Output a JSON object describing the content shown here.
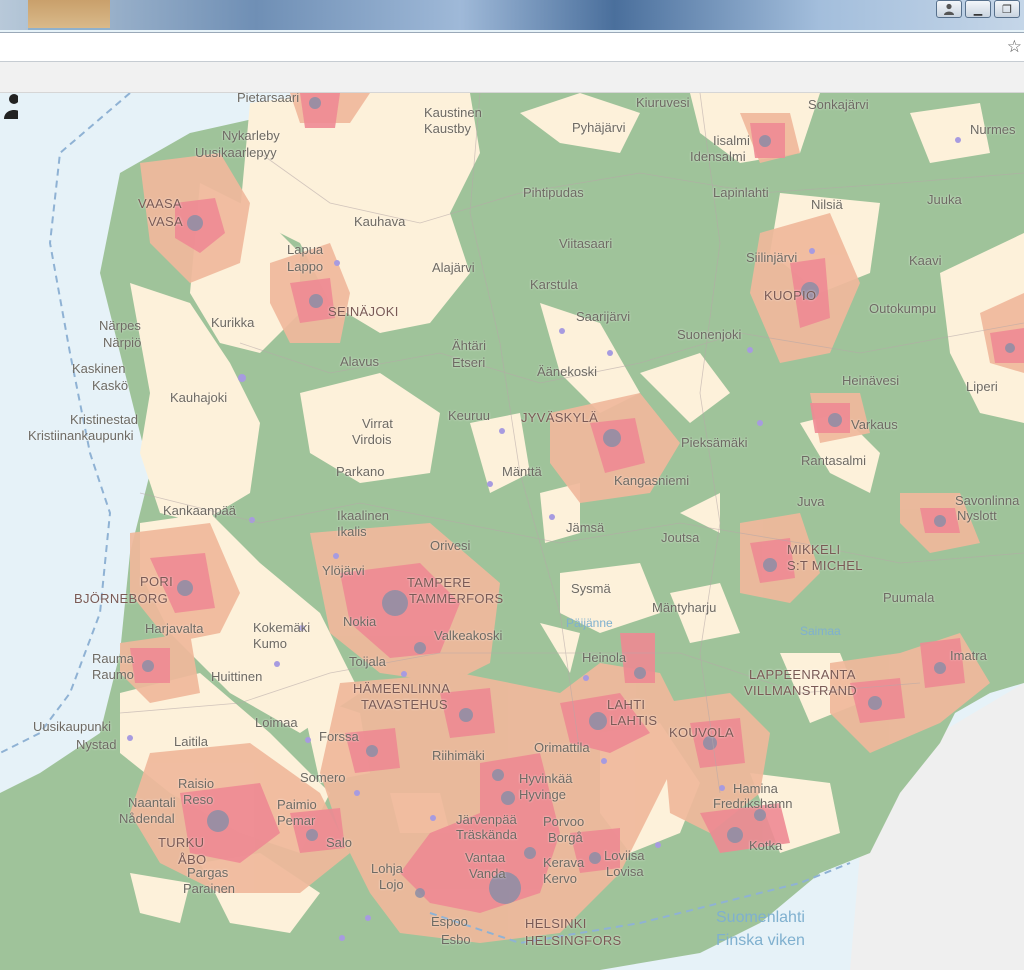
{
  "window": {
    "minimize_label": "▁",
    "restore_label": "❐",
    "account_icon": "user-account-icon"
  },
  "colors": {
    "sea": "#e6f2f8",
    "forest": "#9fc39a",
    "open": "#fdf1da",
    "zone_low": "#f0b99c",
    "zone_high": "#ee8a93",
    "urban": "#8c8ea6"
  },
  "map": {
    "places": [
      {
        "id": "pietarsaari",
        "text": "Pietarsaari"
      },
      {
        "id": "kaustinen",
        "text": "Kaustinen"
      },
      {
        "id": "kaustby",
        "text": "Kaustby"
      },
      {
        "id": "kiuruvesi",
        "text": "Kiuruvesi"
      },
      {
        "id": "sonkajarvi",
        "text": "Sonkajärvi"
      },
      {
        "id": "nurmes",
        "text": "Nurmes"
      },
      {
        "id": "nykarleby",
        "text": "Nykarleby"
      },
      {
        "id": "uusikaarlepyy",
        "text": "Uusikaarlepyy"
      },
      {
        "id": "pyhajarvi",
        "text": "Pyhäjärvi"
      },
      {
        "id": "iisalmi",
        "text": "Iisalmi"
      },
      {
        "id": "idensalmi",
        "text": "Idensalmi"
      },
      {
        "id": "pihtipudas",
        "text": "Pihtipudas"
      },
      {
        "id": "lapinlahti",
        "text": "Lapinlahti"
      },
      {
        "id": "nilsia",
        "text": "Nilsiä"
      },
      {
        "id": "juuka",
        "text": "Juuka"
      },
      {
        "id": "vaasa",
        "text": "VAASA"
      },
      {
        "id": "vasa",
        "text": "VASA"
      },
      {
        "id": "kauhava",
        "text": "Kauhava"
      },
      {
        "id": "lapua",
        "text": "Lapua"
      },
      {
        "id": "lappo",
        "text": "Lappo"
      },
      {
        "id": "viitasaari",
        "text": "Viitasaari"
      },
      {
        "id": "siilinjarvi",
        "text": "Siilinjärvi"
      },
      {
        "id": "kaavi",
        "text": "Kaavi"
      },
      {
        "id": "alajarvi",
        "text": "Alajärvi"
      },
      {
        "id": "karstula",
        "text": "Karstula"
      },
      {
        "id": "kuopio",
        "text": "KUOPIO"
      },
      {
        "id": "seinajoki",
        "text": "SEINÄJOKI"
      },
      {
        "id": "saarijarvi",
        "text": "Saarijärvi"
      },
      {
        "id": "outokumpu",
        "text": "Outokumpu"
      },
      {
        "id": "narpes",
        "text": "Närpes"
      },
      {
        "id": "narpio",
        "text": "Närpiö"
      },
      {
        "id": "kurikka",
        "text": "Kurikka"
      },
      {
        "id": "suonenjoki",
        "text": "Suonenjoki"
      },
      {
        "id": "ahtari",
        "text": "Ähtäri"
      },
      {
        "id": "etseri",
        "text": "Etseri"
      },
      {
        "id": "alavus",
        "text": "Alavus"
      },
      {
        "id": "kaskinen",
        "text": "Kaskinen"
      },
      {
        "id": "kasko",
        "text": "Kaskö"
      },
      {
        "id": "aanekoski",
        "text": "Äänekoski"
      },
      {
        "id": "heinavesi",
        "text": "Heinävesi"
      },
      {
        "id": "liperi",
        "text": "Liperi"
      },
      {
        "id": "kauhajoki",
        "text": "Kauhajoki"
      },
      {
        "id": "kristinestad",
        "text": "Kristinestad"
      },
      {
        "id": "kristiinankaupunki",
        "text": "Kristiinankaupunki"
      },
      {
        "id": "keuruu",
        "text": "Keuruu"
      },
      {
        "id": "jyvaskyla",
        "text": "JYVÄSKYLÄ"
      },
      {
        "id": "virrat",
        "text": "Virrat"
      },
      {
        "id": "virdois",
        "text": "Virdois"
      },
      {
        "id": "varkaus",
        "text": "Varkaus"
      },
      {
        "id": "pieksamaki",
        "text": "Pieksämäki"
      },
      {
        "id": "rantasalmi",
        "text": "Rantasalmi"
      },
      {
        "id": "parkano",
        "text": "Parkano"
      },
      {
        "id": "mantta",
        "text": "Mänttä"
      },
      {
        "id": "kangasniemi",
        "text": "Kangasniemi"
      },
      {
        "id": "juva",
        "text": "Juva"
      },
      {
        "id": "savonlinna",
        "text": "Savonlinna"
      },
      {
        "id": "nyslott",
        "text": "Nyslott"
      },
      {
        "id": "kankaanpaa",
        "text": "Kankaanpää"
      },
      {
        "id": "ikaalinen",
        "text": "Ikaalinen"
      },
      {
        "id": "ikalis",
        "text": "Ikalis"
      },
      {
        "id": "jamsa",
        "text": "Jämsä"
      },
      {
        "id": "joutsa",
        "text": "Joutsa"
      },
      {
        "id": "orivesi",
        "text": "Orivesi"
      },
      {
        "id": "mikkeli",
        "text": "MIKKELI"
      },
      {
        "id": "st_michel",
        "text": "S:T MICHEL"
      },
      {
        "id": "ylojarvi",
        "text": "Ylöjärvi"
      },
      {
        "id": "tampere",
        "text": "TAMPERE"
      },
      {
        "id": "tammerfors",
        "text": "TAMMERFORS"
      },
      {
        "id": "pori",
        "text": "PORI"
      },
      {
        "id": "bjorneborg",
        "text": "BJÖRNEBORG"
      },
      {
        "id": "sysma",
        "text": "Sysmä"
      },
      {
        "id": "mantyharju",
        "text": "Mäntyharju"
      },
      {
        "id": "puumala",
        "text": "Puumala"
      },
      {
        "id": "harjavalta",
        "text": "Harjavalta"
      },
      {
        "id": "kokemaki",
        "text": "Kokemäki"
      },
      {
        "id": "kumo",
        "text": "Kumo"
      },
      {
        "id": "nokia",
        "text": "Nokia"
      },
      {
        "id": "valkeakoski",
        "text": "Valkeakoski"
      },
      {
        "id": "paijanne",
        "text": "Päijänne"
      },
      {
        "id": "saimaa",
        "text": "Saimaa"
      },
      {
        "id": "rauma",
        "text": "Rauma"
      },
      {
        "id": "raumo",
        "text": "Raumo"
      },
      {
        "id": "toijala",
        "text": "Toijala"
      },
      {
        "id": "heinola",
        "text": "Heinola"
      },
      {
        "id": "imatra",
        "text": "Imatra"
      },
      {
        "id": "huittinen",
        "text": "Huittinen"
      },
      {
        "id": "hameenlinna",
        "text": "HÄMEENLINNA"
      },
      {
        "id": "tavastehus",
        "text": "TAVASTEHUS"
      },
      {
        "id": "lahti",
        "text": "LAHTI"
      },
      {
        "id": "lahtis",
        "text": "LAHTIS"
      },
      {
        "id": "lappeenranta",
        "text": "LAPPEENRANTA"
      },
      {
        "id": "villmanstrand",
        "text": "VILLMANSTRAND"
      },
      {
        "id": "loimaa",
        "text": "Loimaa"
      },
      {
        "id": "forssa",
        "text": "Forssa"
      },
      {
        "id": "uusikaupunki",
        "text": "Uusikaupunki"
      },
      {
        "id": "nystad",
        "text": "Nystad"
      },
      {
        "id": "laitila",
        "text": "Laitila"
      },
      {
        "id": "riihimaki",
        "text": "Riihimäki"
      },
      {
        "id": "orimattila",
        "text": "Orimattila"
      },
      {
        "id": "kouvola",
        "text": "KOUVOLA"
      },
      {
        "id": "somero",
        "text": "Somero"
      },
      {
        "id": "hyvinkaa",
        "text": "Hyvinkää"
      },
      {
        "id": "hyvinge",
        "text": "Hyvinge"
      },
      {
        "id": "hamina",
        "text": "Hamina"
      },
      {
        "id": "fredrikshamn",
        "text": "Fredrikshamn"
      },
      {
        "id": "raisio",
        "text": "Raisio"
      },
      {
        "id": "reso",
        "text": "Reso"
      },
      {
        "id": "naantali",
        "text": "Naantali"
      },
      {
        "id": "nadendal",
        "text": "Nådendal"
      },
      {
        "id": "paimio",
        "text": "Paimio"
      },
      {
        "id": "pemar",
        "text": "Pemar"
      },
      {
        "id": "jarvenpaa",
        "text": "Järvenpää"
      },
      {
        "id": "traskanda",
        "text": "Träskända"
      },
      {
        "id": "porvoo",
        "text": "Porvoo"
      },
      {
        "id": "borga",
        "text": "Borgå"
      },
      {
        "id": "turku",
        "text": "TURKU"
      },
      {
        "id": "abo",
        "text": "ÅBO"
      },
      {
        "id": "salo",
        "text": "Salo"
      },
      {
        "id": "kotka",
        "text": "Kotka"
      },
      {
        "id": "vantaa",
        "text": "Vantaa"
      },
      {
        "id": "vanda",
        "text": "Vanda"
      },
      {
        "id": "kerava",
        "text": "Kerava"
      },
      {
        "id": "kervo",
        "text": "Kervo"
      },
      {
        "id": "loviisa",
        "text": "Loviisa"
      },
      {
        "id": "lovisa",
        "text": "Lovisa"
      },
      {
        "id": "lohja",
        "text": "Lohja"
      },
      {
        "id": "lojo",
        "text": "Lojo"
      },
      {
        "id": "pargas",
        "text": "Pargas"
      },
      {
        "id": "parainen",
        "text": "Parainen"
      },
      {
        "id": "espoo",
        "text": "Espoo"
      },
      {
        "id": "esbo",
        "text": "Esbo"
      },
      {
        "id": "helsinki",
        "text": "HELSINKI"
      },
      {
        "id": "helsingfors",
        "text": "HELSINGFORS"
      },
      {
        "id": "suomenlahti",
        "text": "Suomenlahti"
      },
      {
        "id": "finska_viken",
        "text": "Finska viken"
      }
    ]
  }
}
